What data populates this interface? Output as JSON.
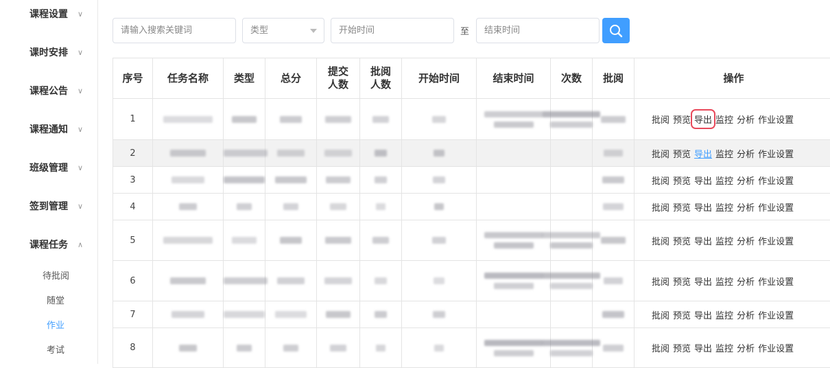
{
  "sidebar": {
    "items": [
      {
        "label": "课程设置",
        "expanded": false
      },
      {
        "label": "课时安排",
        "expanded": false
      },
      {
        "label": "课程公告",
        "expanded": false
      },
      {
        "label": "课程通知",
        "expanded": false
      },
      {
        "label": "班级管理",
        "expanded": false
      },
      {
        "label": "签到管理",
        "expanded": false
      },
      {
        "label": "课程任务",
        "expanded": true
      }
    ],
    "sub_items": [
      {
        "label": "待批阅",
        "active": false
      },
      {
        "label": "随堂",
        "active": false
      },
      {
        "label": "作业",
        "active": true
      },
      {
        "label": "考试",
        "active": false
      }
    ],
    "chevron_down": "∨",
    "chevron_up": "∧"
  },
  "filters": {
    "search_placeholder": "请输入搜索关键词",
    "type_placeholder": "类型",
    "start_placeholder": "开始时间",
    "to_label": "至",
    "end_placeholder": "结束时间"
  },
  "table": {
    "headers": {
      "index": "序号",
      "name": "任务名称",
      "type": "类型",
      "total": "总分",
      "submit1": "提交",
      "submit2": "人数",
      "review1": "批阅",
      "review2": "人数",
      "start": "开始时间",
      "end": "结束时间",
      "times": "次数",
      "review": "批阅",
      "actions": "操作"
    },
    "actions": [
      "批阅",
      "预览",
      "导出",
      "监控",
      "分析",
      "作业设置"
    ],
    "rows": [
      {
        "index": "1",
        "highlighted_action": "导出",
        "has_dates": true
      },
      {
        "index": "2",
        "link_action": "导出",
        "has_dates": false
      },
      {
        "index": "3",
        "has_dates": false
      },
      {
        "index": "4",
        "has_dates": false
      },
      {
        "index": "5",
        "has_dates": true
      },
      {
        "index": "6",
        "has_dates": true
      },
      {
        "index": "7",
        "has_dates": false
      },
      {
        "index": "8",
        "has_dates": true
      }
    ]
  },
  "colors": {
    "accent": "#409eff",
    "highlight_box": "#e8495a",
    "row_gray": "#f2f2f2"
  }
}
